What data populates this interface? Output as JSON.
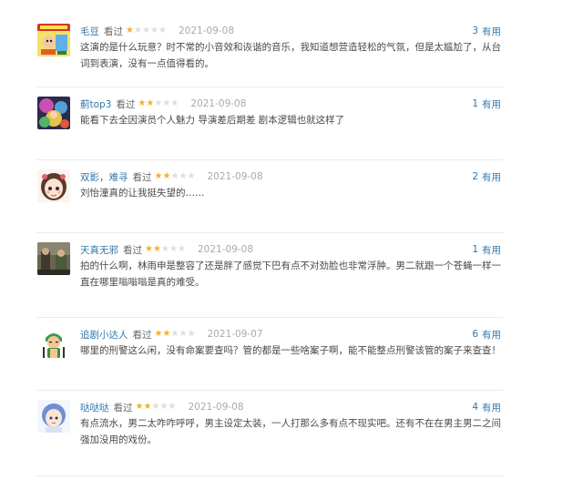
{
  "comments": [
    {
      "username": "毛豆",
      "status": "看过",
      "rating": 1,
      "date": "2021-09-08",
      "votes": "3",
      "votes_label": "有用",
      "text": "这演的是什么玩意？时不常的小音效和诙谐的音乐，我知道想营造轻松的气氛，但是太尴尬了，从台词到表演，没有一点值得看的。",
      "avatar_icon": "comic-cover-avatar"
    },
    {
      "username": "蓟top3",
      "status": "看过",
      "rating": 2,
      "date": "2021-09-08",
      "votes": "1",
      "votes_label": "有用",
      "text": "能看下去全因演员个人魅力 导演差后期差 剧本逻辑也就这样了",
      "avatar_icon": "colorful-photo-avatar"
    },
    {
      "username": "双影，难寻",
      "status": "看过",
      "rating": 2,
      "date": "2021-09-08",
      "votes": "2",
      "votes_label": "有用",
      "text": "刘怡潼真的让我挺失望的……",
      "avatar_icon": "anime-girl-avatar"
    },
    {
      "username": "天真无邪",
      "status": "看过",
      "rating": 2,
      "date": "2021-09-08",
      "votes": "1",
      "votes_label": "有用",
      "text": "拍的什么啊，林雨申是整容了还是胖了感觉下巴有点不对劲脸也非常浮肿。男二就跟一个苍蝇一样一直在哪里嗡嗡嗡是真的难受。",
      "avatar_icon": "movie-still-avatar"
    },
    {
      "username": "追剧小达人",
      "status": "看过",
      "rating": 2,
      "date": "2021-09-07",
      "votes": "6",
      "votes_label": "有用",
      "text": "哪里的刑警这么闲，没有命案要查吗？管的都是一些啥案子啊，能不能整点刑警该管的案子来查查！",
      "avatar_icon": "green-hair-swordsman-avatar"
    },
    {
      "username": "哒哒哒",
      "status": "看过",
      "rating": 2,
      "date": "2021-09-08",
      "votes": "4",
      "votes_label": "有用",
      "text": "有点流水，男二太咋咋呼呼，男主设定太装，一人打那么多有点不现实吧。还有不在在男主男二之间强加没用的戏份。",
      "avatar_icon": "blue-hair-girl-avatar"
    }
  ],
  "colors": {
    "link": "#3377aa",
    "star_on": "#f6b02a",
    "star_off": "#dddddd",
    "date": "#aaaaaa",
    "text": "#494949",
    "divider": "#ebebeb"
  }
}
